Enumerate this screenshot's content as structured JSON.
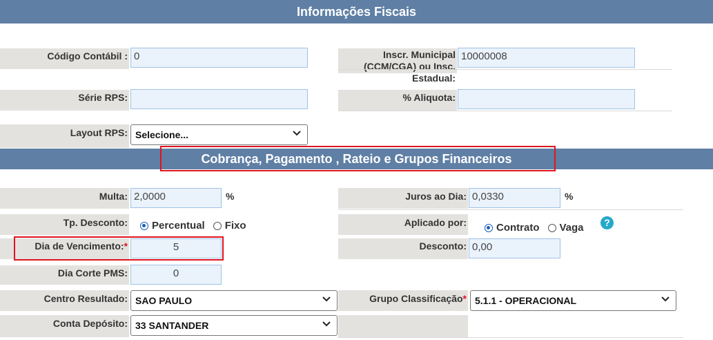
{
  "sections": {
    "fiscal_title": "Informações Fiscais",
    "billing_title": "Cobrança, Pagamento , Rateio e Grupos Financeiros"
  },
  "fiscal": {
    "codigo_contabil": {
      "label": "Código Contábil :",
      "value": "0"
    },
    "inscr_municipal": {
      "label": "Inscr. Municipal (CCM/CGA) ou Insc. Estadual:",
      "value": "10000008"
    },
    "serie_rps": {
      "label": "Série RPS:",
      "value": ""
    },
    "aliquota": {
      "label": "% Aliquota:",
      "value": ""
    },
    "layout_rps": {
      "label": "Layout RPS:",
      "selected": "Selecione..."
    }
  },
  "billing": {
    "multa": {
      "label": "Multa:",
      "value": "2,0000",
      "unit": "%"
    },
    "juros": {
      "label": "Juros ao Dia:",
      "value": "0,0330",
      "unit": "%"
    },
    "tp_desconto": {
      "label": "Tp. Desconto:",
      "options": [
        "Percentual",
        "Fixo"
      ],
      "selected": "Percentual"
    },
    "aplicado_por": {
      "label": "Aplicado por:",
      "options": [
        "Contrato",
        "Vaga"
      ],
      "selected": "Contrato",
      "help": "?"
    },
    "dia_vencimento": {
      "label": "Dia de Vencimento:",
      "required_mark": "*",
      "value": "5"
    },
    "desconto": {
      "label": "Desconto:",
      "value": "0,00"
    },
    "dia_corte": {
      "label": "Dia Corte PMS:",
      "value": "0"
    },
    "centro_resultado": {
      "label": "Centro Resultado:",
      "selected": "SAO PAULO"
    },
    "grupo_classificacao": {
      "label": "Grupo Classificação",
      "required_mark": "*",
      "selected": "5.1.1 - OPERACIONAL"
    },
    "conta_deposito": {
      "label": "Conta Depósito:",
      "selected": "33 SANTANDER"
    }
  },
  "colors": {
    "band": "#5f7fa5",
    "label_bg": "#e4e2df",
    "input_bg": "#eaf2fb",
    "highlight": "#e0141e",
    "radio": "#1a5fb4"
  }
}
